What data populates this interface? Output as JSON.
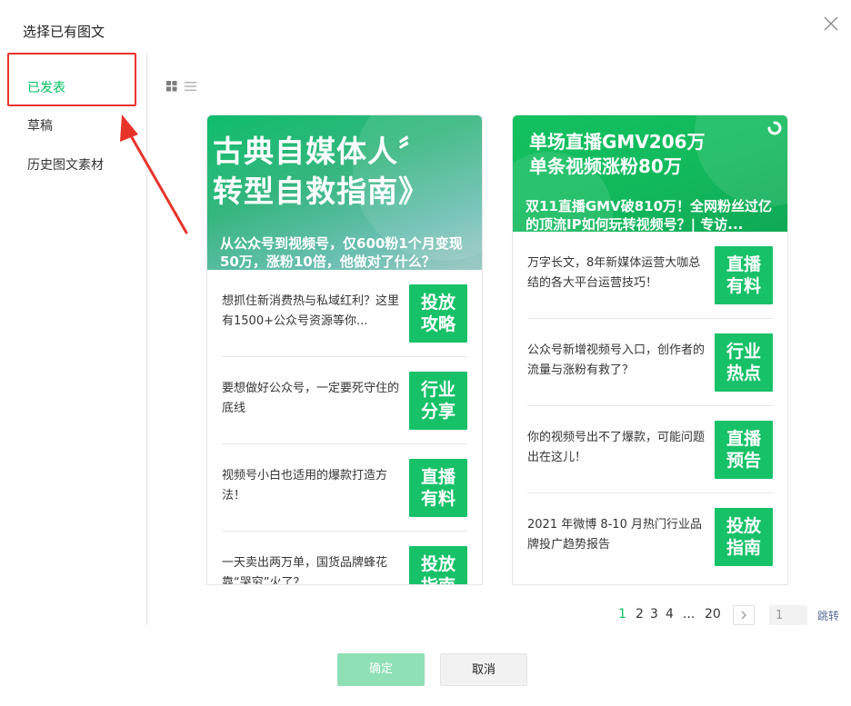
{
  "dialog": {
    "title": "选择已有图文",
    "close_icon": "close-icon"
  },
  "nav": {
    "items": [
      {
        "label": "已发表",
        "active": true
      },
      {
        "label": "草稿",
        "active": false
      },
      {
        "label": "历史图文素材",
        "active": false
      }
    ]
  },
  "colors": {
    "accent": "#07c160",
    "annotation": "#e8332b",
    "thumb": "#17c167"
  },
  "cards": [
    {
      "cover_title_line1": "古典自媒体人〞",
      "cover_title_line2": "转型自救指南》",
      "cover_subtitle": "从公众号到视频号，仅600粉1个月变现50万，涨粉10倍，他做对了什么？",
      "items": [
        {
          "text": "想抓住新消费热与私域红利？这里有1500+公众号资源等你...",
          "thumb_line1": "投放",
          "thumb_line2": "攻略"
        },
        {
          "text": "要想做好公众号，一定要死守住的底线",
          "thumb_line1": "行业",
          "thumb_line2": "分享"
        },
        {
          "text": "视频号小白也适用的爆款打造方法！",
          "thumb_line1": "直播",
          "thumb_line2": "有料"
        },
        {
          "text": "一天卖出两万单，国货品牌蜂花靠“哭穷”火了？",
          "thumb_line1": "投放",
          "thumb_line2": "指南"
        }
      ]
    },
    {
      "cover_title_line1": "单场直播GMV206万",
      "cover_title_line2": "单条视频涨粉80万",
      "cover_subtitle": "双11直播GMV破810万！全网粉丝过亿的顶流IP如何玩转视频号？| 专访...",
      "items": [
        {
          "text": "万字长文，8年新媒体运营大咖总结的各大平台运营技巧！",
          "thumb_line1": "直播",
          "thumb_line2": "有料"
        },
        {
          "text": "公众号新增视频号入口，创作者的流量与涨粉有救了？",
          "thumb_line1": "行业",
          "thumb_line2": "热点"
        },
        {
          "text": "你的视频号出不了爆款，可能问题出在这儿！",
          "thumb_line1": "直播",
          "thumb_line2": "预告"
        },
        {
          "text": "2021 年微博 8-10 月热门行业品牌投广趋势报告",
          "thumb_line1": "投放",
          "thumb_line2": "指南"
        }
      ]
    }
  ],
  "pagination": {
    "pages": [
      "1",
      "2",
      "3",
      "4",
      "...",
      "20"
    ],
    "current": "1",
    "input_value": "1",
    "jump_label": "跳转"
  },
  "buttons": {
    "ok_label": "确定",
    "cancel_label": "取消"
  }
}
